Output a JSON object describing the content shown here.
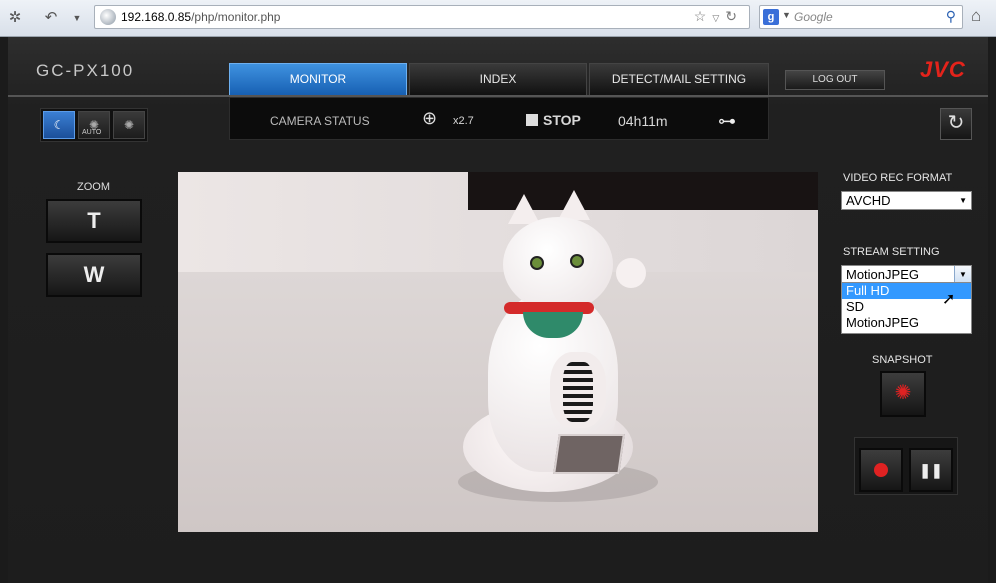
{
  "browser": {
    "url_host": "192.168.0.85",
    "url_path": "/php/monitor.php",
    "search_placeholder": "Google"
  },
  "header": {
    "model": "GC-PX100",
    "brand": "JVC",
    "brand_color": "#e4231b",
    "tabs": [
      {
        "label": "MONITOR",
        "active": true
      },
      {
        "label": "INDEX",
        "active": false
      },
      {
        "label": "DETECT/MAIL SETTING",
        "active": false
      }
    ],
    "logout_label": "LOG OUT"
  },
  "mode_buttons": [
    {
      "icon": "night-mode-icon",
      "active": true,
      "sub": ""
    },
    {
      "icon": "auto-light-icon",
      "active": false,
      "sub": "AUTO"
    },
    {
      "icon": "light-icon",
      "active": false,
      "sub": ""
    }
  ],
  "status_bar": {
    "label": "CAMERA STATUS",
    "zoom_value": "x2.7",
    "rec_state": "STOP",
    "remaining_time": "04h11m"
  },
  "zoom": {
    "label": "ZOOM",
    "tele_label": "T",
    "wide_label": "W"
  },
  "video_rec_format": {
    "label": "VIDEO REC FORMAT",
    "selected": "AVCHD"
  },
  "stream_setting": {
    "label": "STREAM SETTING",
    "selected": "MotionJPEG",
    "options": [
      "Full HD",
      "SD",
      "MotionJPEG"
    ],
    "highlighted_option": "Full HD"
  },
  "snapshot": {
    "label": "SNAPSHOT"
  },
  "colors": {
    "accent": "#2a7bd4",
    "record": "#e02222"
  }
}
